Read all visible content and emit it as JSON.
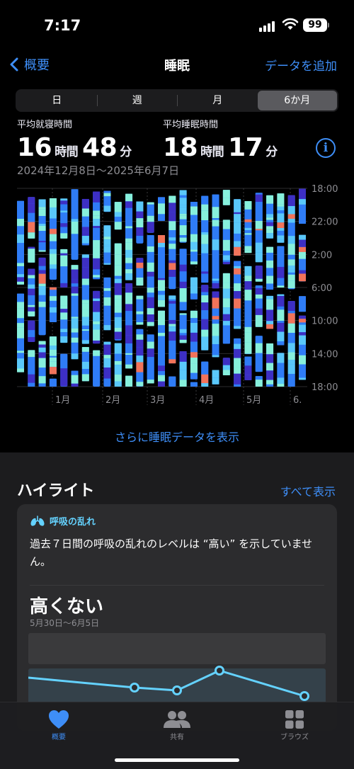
{
  "status": {
    "time": "7:17",
    "battery": "99"
  },
  "nav": {
    "back_label": "概要",
    "title": "睡眠",
    "add_label": "データを追加"
  },
  "segments": [
    "日",
    "週",
    "月",
    "6か月"
  ],
  "selected_segment": "6か月",
  "summary": {
    "bedtime_label": "平均就寝時間",
    "bedtime_hours": "16",
    "bedtime_minutes": "48",
    "sleep_label": "平均睡眠時間",
    "sleep_hours": "18",
    "sleep_minutes": "17",
    "hour_unit": "時間",
    "minute_unit": "分",
    "date_range": "2024年12月8日〜2025年6月7日"
  },
  "colors": {
    "awake": "#f2735a",
    "rem": "#5ac8fa",
    "core": "#2f7cf6",
    "deep": "#3d2fc4",
    "inbed": "#87f0dc",
    "accent": "#3e8ef7"
  },
  "chart_data": {
    "type": "bar",
    "y_ticks": [
      "18:00",
      "22:00",
      "2:00",
      "6:00",
      "10:00",
      "14:00",
      "18:00"
    ],
    "x_ticks": [
      "1月",
      "2月",
      "3月",
      "4月",
      "5月",
      "6."
    ],
    "legend_stages": [
      "awake",
      "rem",
      "core",
      "deep",
      "inbed"
    ]
  },
  "more_link": "さらに睡眠データを表示",
  "highlights": {
    "title": "ハイライト",
    "see_all": "すべて表示",
    "card": {
      "tag": "呼吸の乱れ",
      "body": "過去７日間の呼吸の乱れのレベルは “高い” を示していません。",
      "value": "高くない",
      "dates": "5月30日〜6月5日"
    }
  },
  "tabs": [
    {
      "label": "概要",
      "icon": "heart-icon"
    },
    {
      "label": "共有",
      "icon": "people-icon"
    },
    {
      "label": "ブラウズ",
      "icon": "grid-icon"
    }
  ]
}
